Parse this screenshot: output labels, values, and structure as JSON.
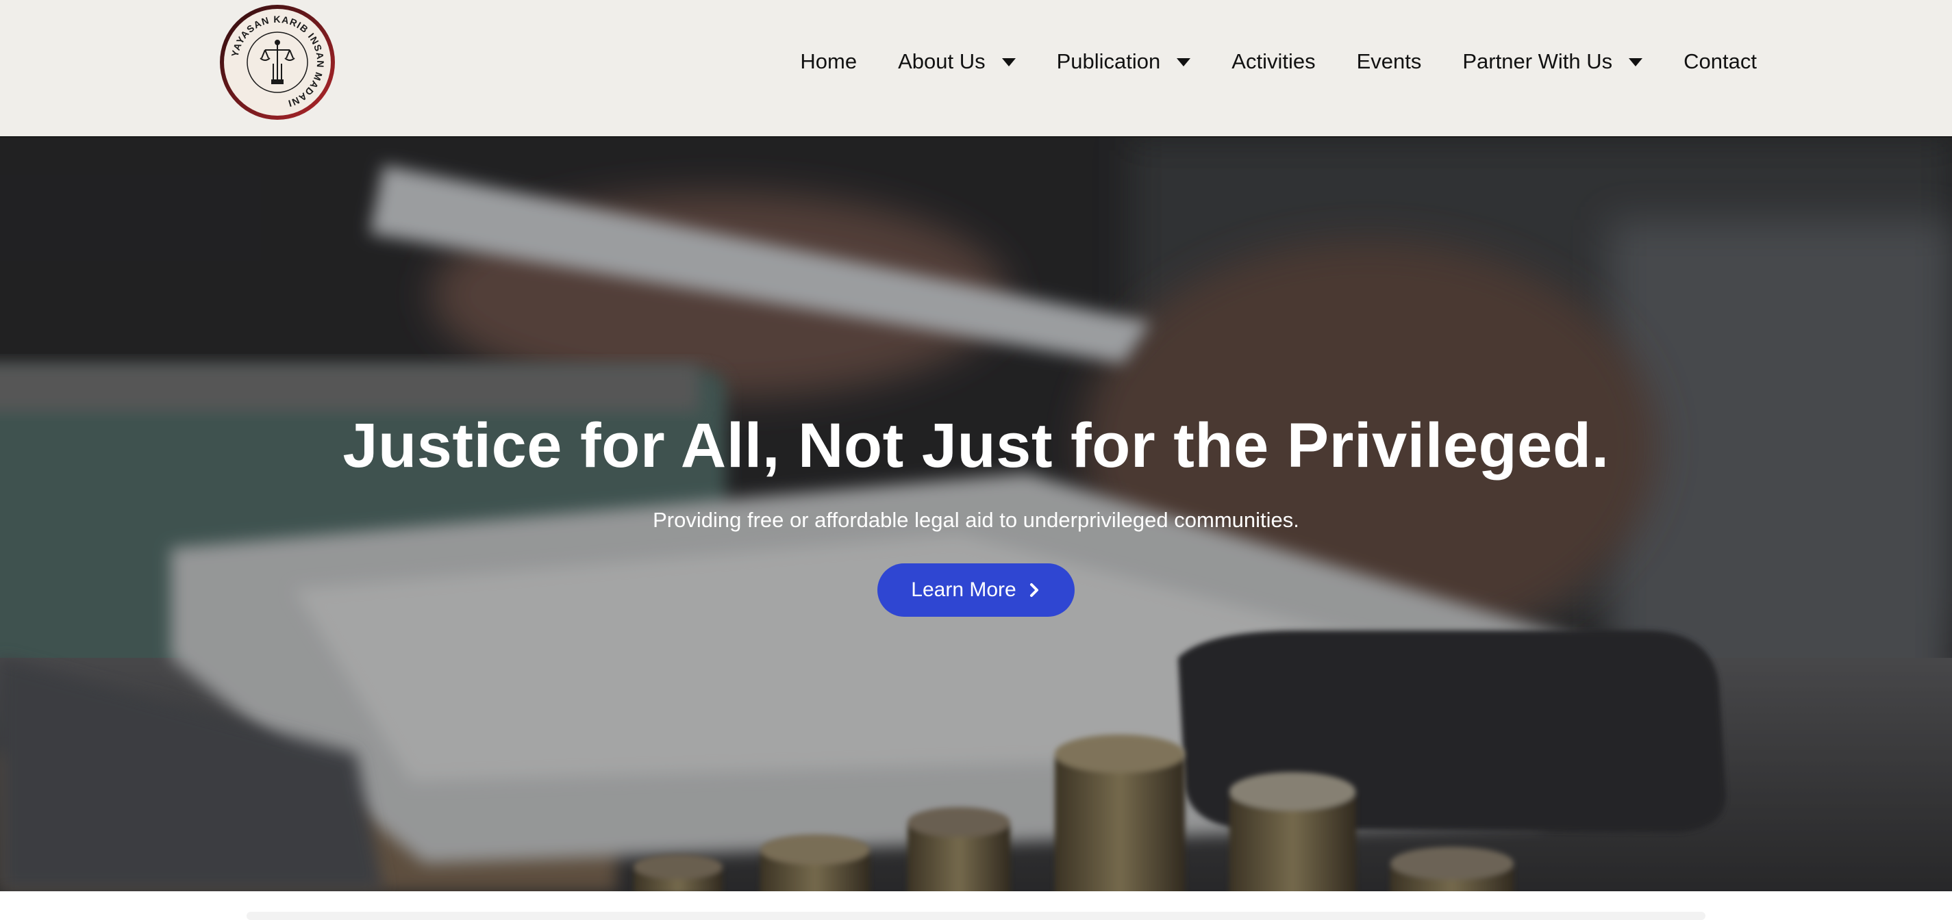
{
  "brand": {
    "logo_text": "YAYASAN KARIB INSAN MADANI",
    "logo_icon": "scales-of-justice-icon",
    "colors": {
      "ring": "#8b1e22",
      "ink": "#1a1a1a"
    }
  },
  "nav": {
    "items": [
      {
        "label": "Home",
        "has_dropdown": false
      },
      {
        "label": "About Us",
        "has_dropdown": true
      },
      {
        "label": "Publication",
        "has_dropdown": true
      },
      {
        "label": "Activities",
        "has_dropdown": false
      },
      {
        "label": "Events",
        "has_dropdown": false
      },
      {
        "label": "Partner With Us",
        "has_dropdown": true
      },
      {
        "label": "Contact",
        "has_dropdown": false
      }
    ]
  },
  "hero": {
    "title": "Justice for All, Not Just for the Privileged.",
    "subtitle": "Providing free or affordable legal aid to underprivileged communities.",
    "cta_label": "Learn More",
    "cta_icon": "chevron-right-icon",
    "cta_color": "#2f46d2"
  }
}
